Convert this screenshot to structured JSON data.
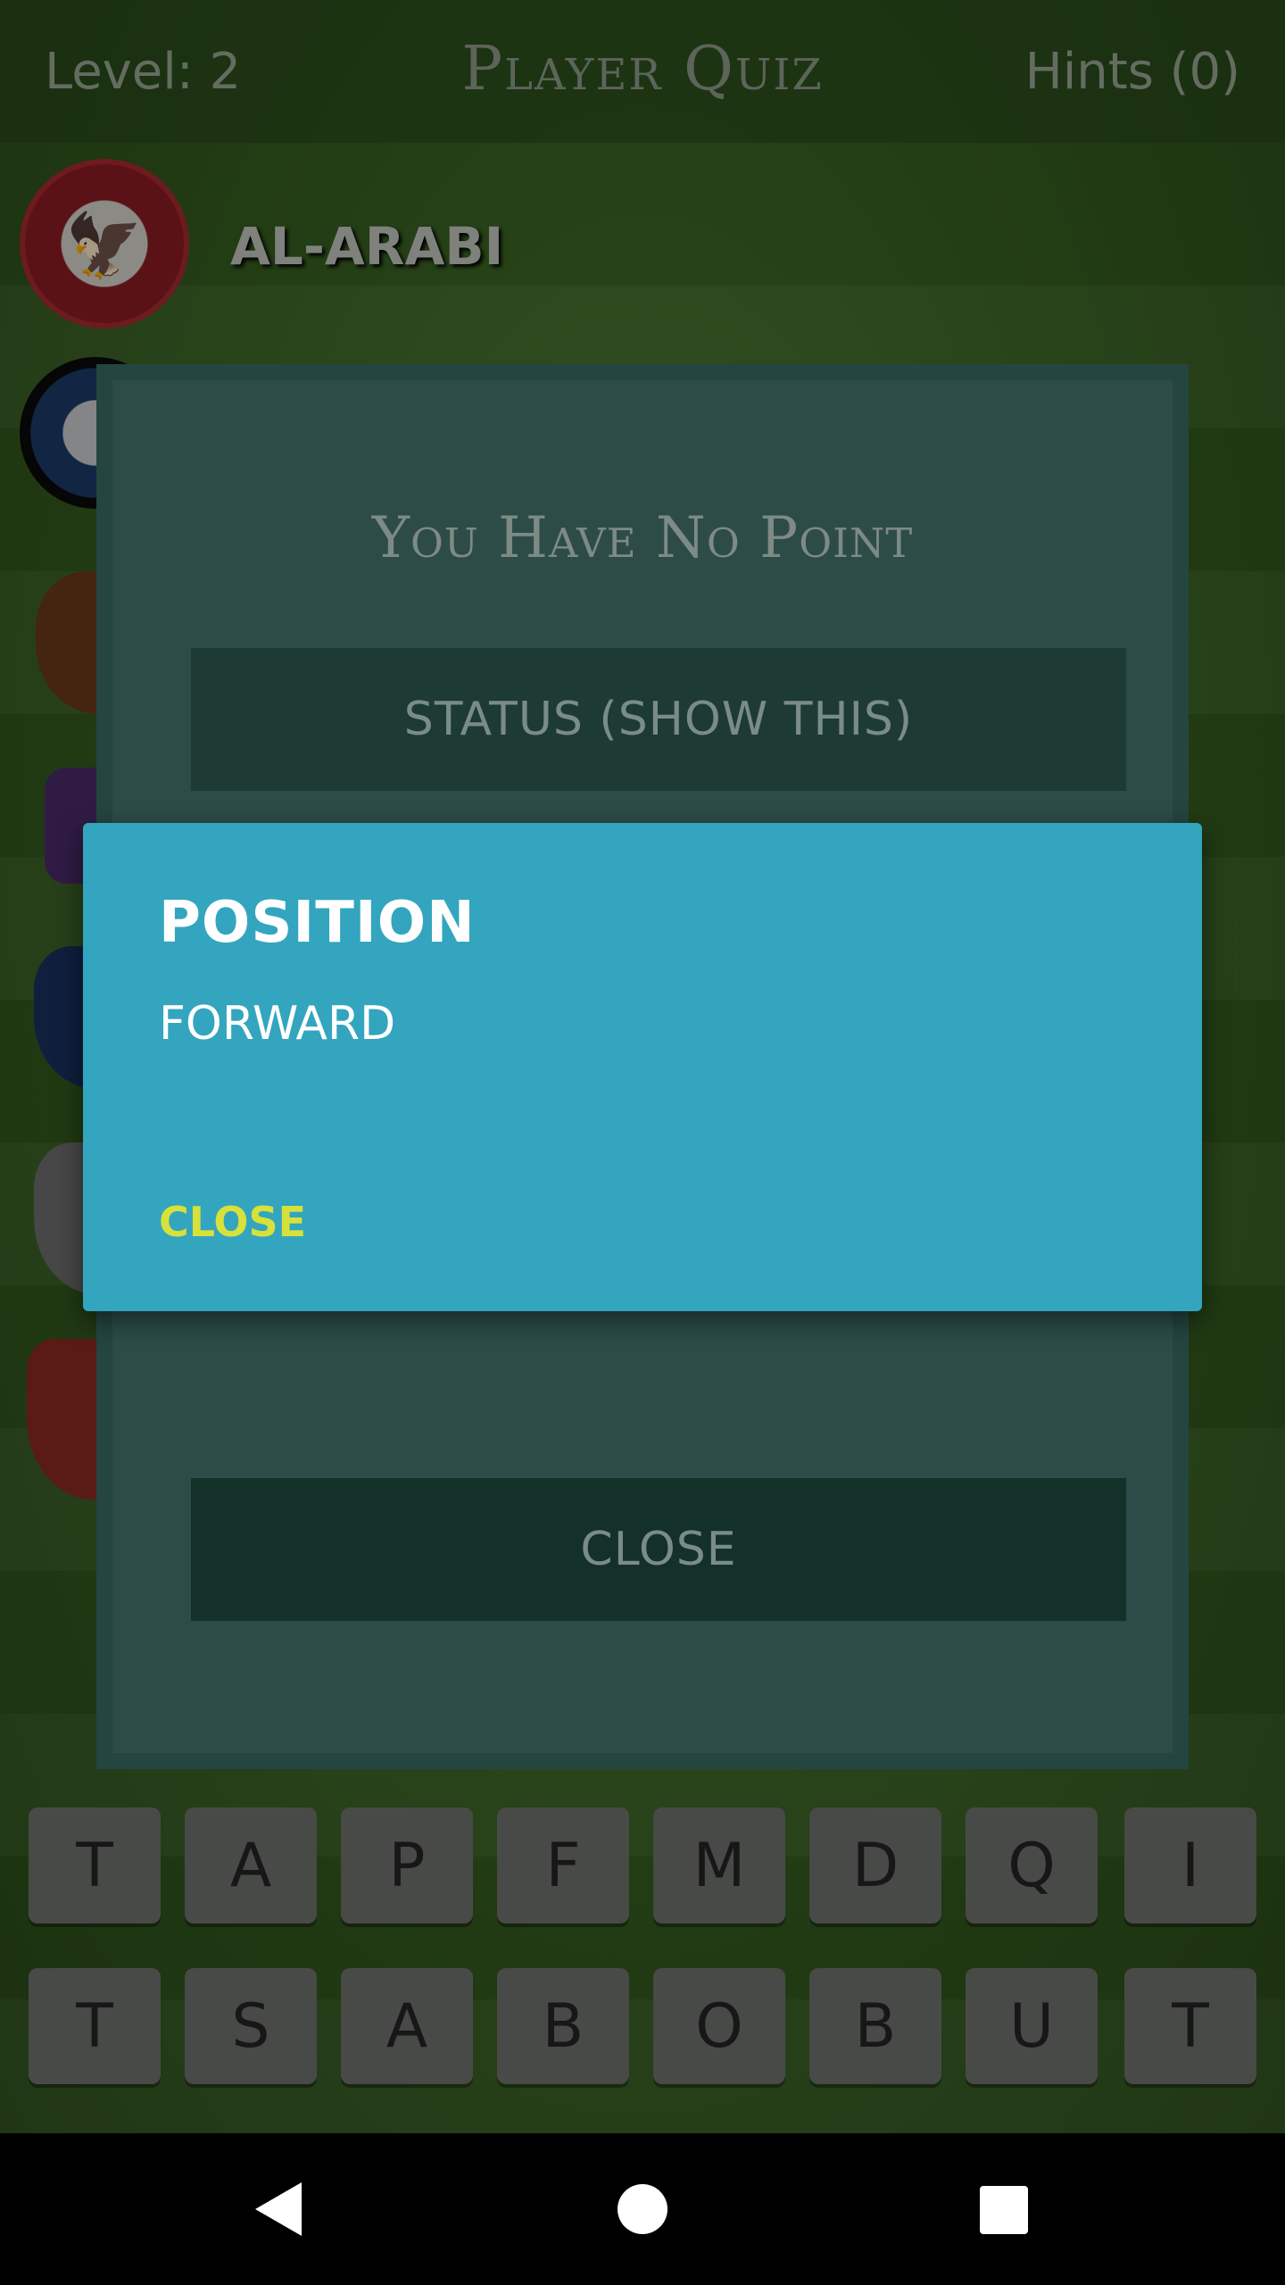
{
  "header": {
    "level": "Level: 2",
    "title": "Player Quiz",
    "hints": "Hints (0)"
  },
  "clubs": {
    "first_name": "AL-ARABI"
  },
  "panel": {
    "title": "You Have No Point",
    "status_button": "STATUS (SHOW THIS)",
    "close_button": "CLOSE"
  },
  "keyboard": {
    "row1": [
      "T",
      "A",
      "P",
      "F",
      "M",
      "D",
      "Q",
      "I"
    ],
    "row2": [
      "T",
      "S",
      "A",
      "B",
      "O",
      "B",
      "U",
      "T"
    ]
  },
  "dialog": {
    "title": "POSITION",
    "message": "FORWARD",
    "close": "CLOSE",
    "background_color": "#33a5bf",
    "close_color": "#d8e03a"
  },
  "navbar": {
    "back": "back-icon",
    "home": "home-icon",
    "recents": "recents-icon"
  }
}
